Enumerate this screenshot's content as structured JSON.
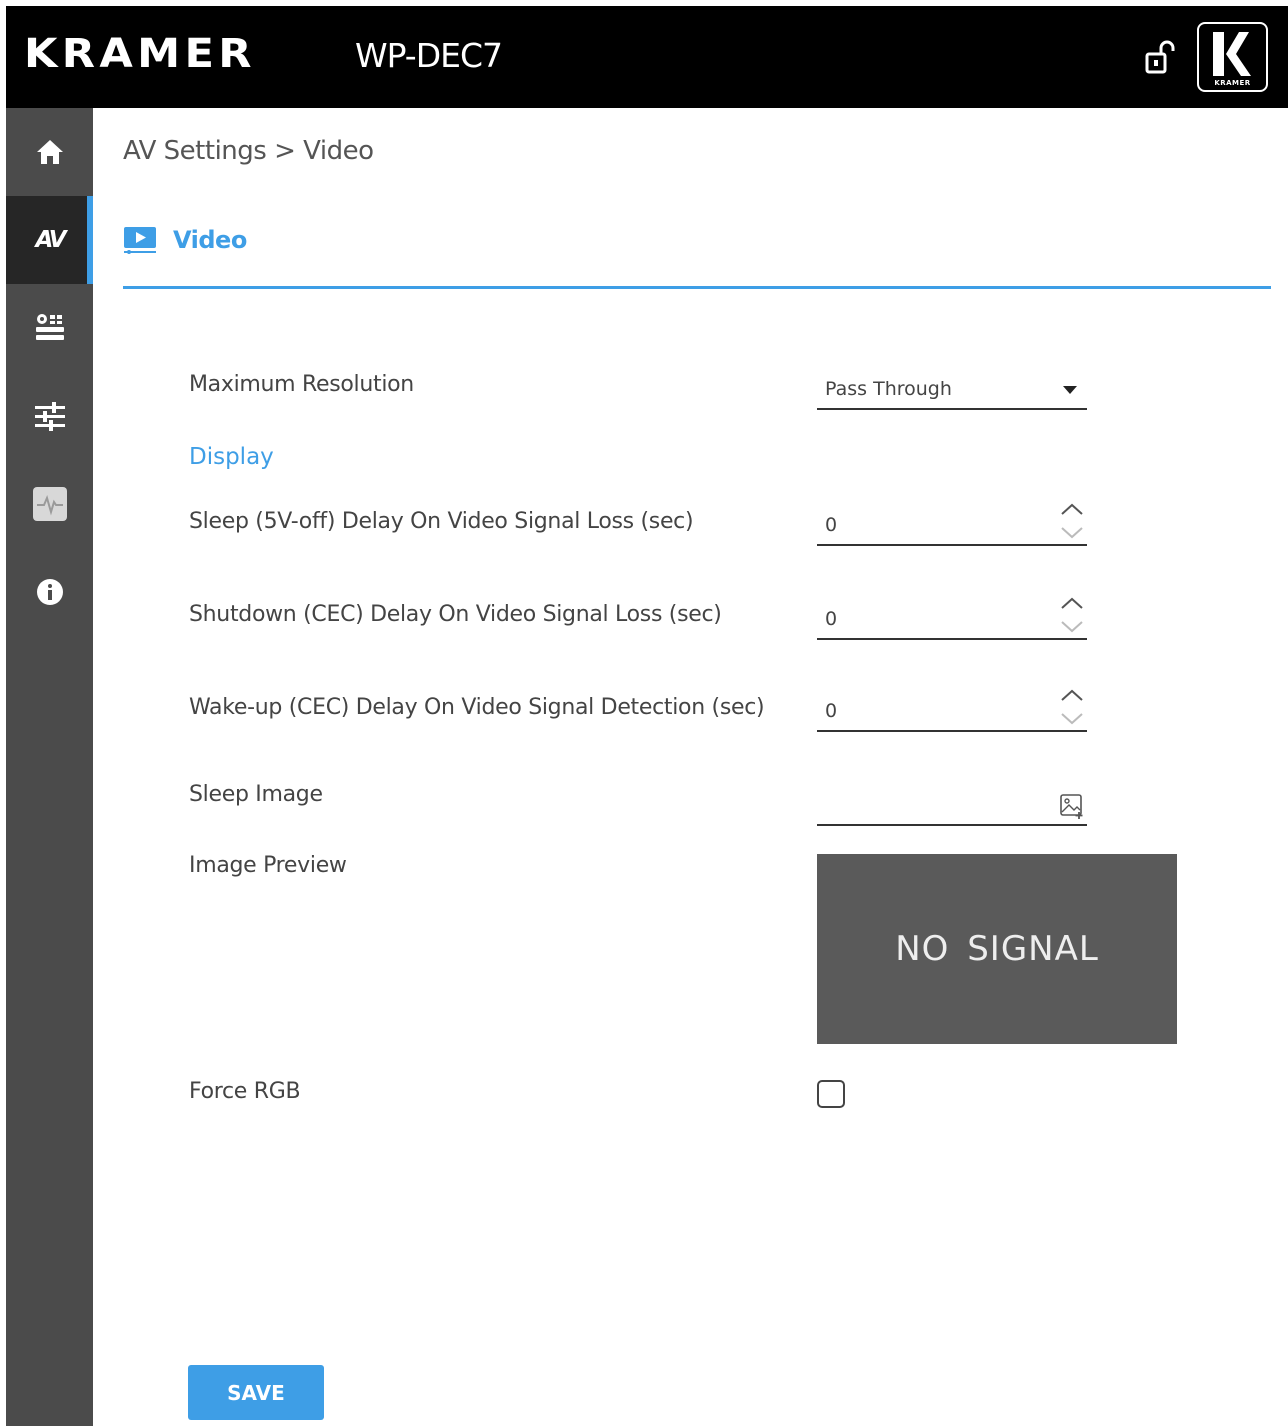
{
  "header": {
    "brand": "KRAMER",
    "model": "WP-DEC7",
    "logo_small_text": "KRAMER"
  },
  "sidebar": {
    "items": [
      {
        "icon": "home-icon"
      },
      {
        "icon": "av-icon",
        "label": "AV",
        "active": true
      },
      {
        "icon": "device-settings-icon"
      },
      {
        "icon": "sliders-icon"
      },
      {
        "icon": "diagnostics-icon"
      },
      {
        "icon": "info-icon"
      }
    ]
  },
  "breadcrumb": "AV Settings > Video",
  "tab": {
    "label": "Video",
    "icon": "video-icon"
  },
  "colors": {
    "accent": "#3e9ee6",
    "header_bg": "#000000",
    "sidebar_bg": "#4b4b4b",
    "preview_bg": "#5a5a5a"
  },
  "form": {
    "max_resolution": {
      "label": "Maximum Resolution",
      "value": "Pass Through"
    },
    "display_section": "Display",
    "sleep_delay": {
      "label": "Sleep (5V-off) Delay On Video Signal Loss (sec)",
      "value": "0"
    },
    "shutdown_delay": {
      "label": "Shutdown (CEC) Delay On Video Signal Loss (sec)",
      "value": "0"
    },
    "wakeup_delay": {
      "label": "Wake-up (CEC) Delay On Video Signal Detection (sec)",
      "value": "0"
    },
    "sleep_image": {
      "label": "Sleep Image",
      "value": ""
    },
    "image_preview": {
      "label": "Image Preview",
      "text": "NO SIGNAL"
    },
    "force_rgb": {
      "label": "Force RGB",
      "checked": false
    }
  },
  "save_label": "SAVE"
}
